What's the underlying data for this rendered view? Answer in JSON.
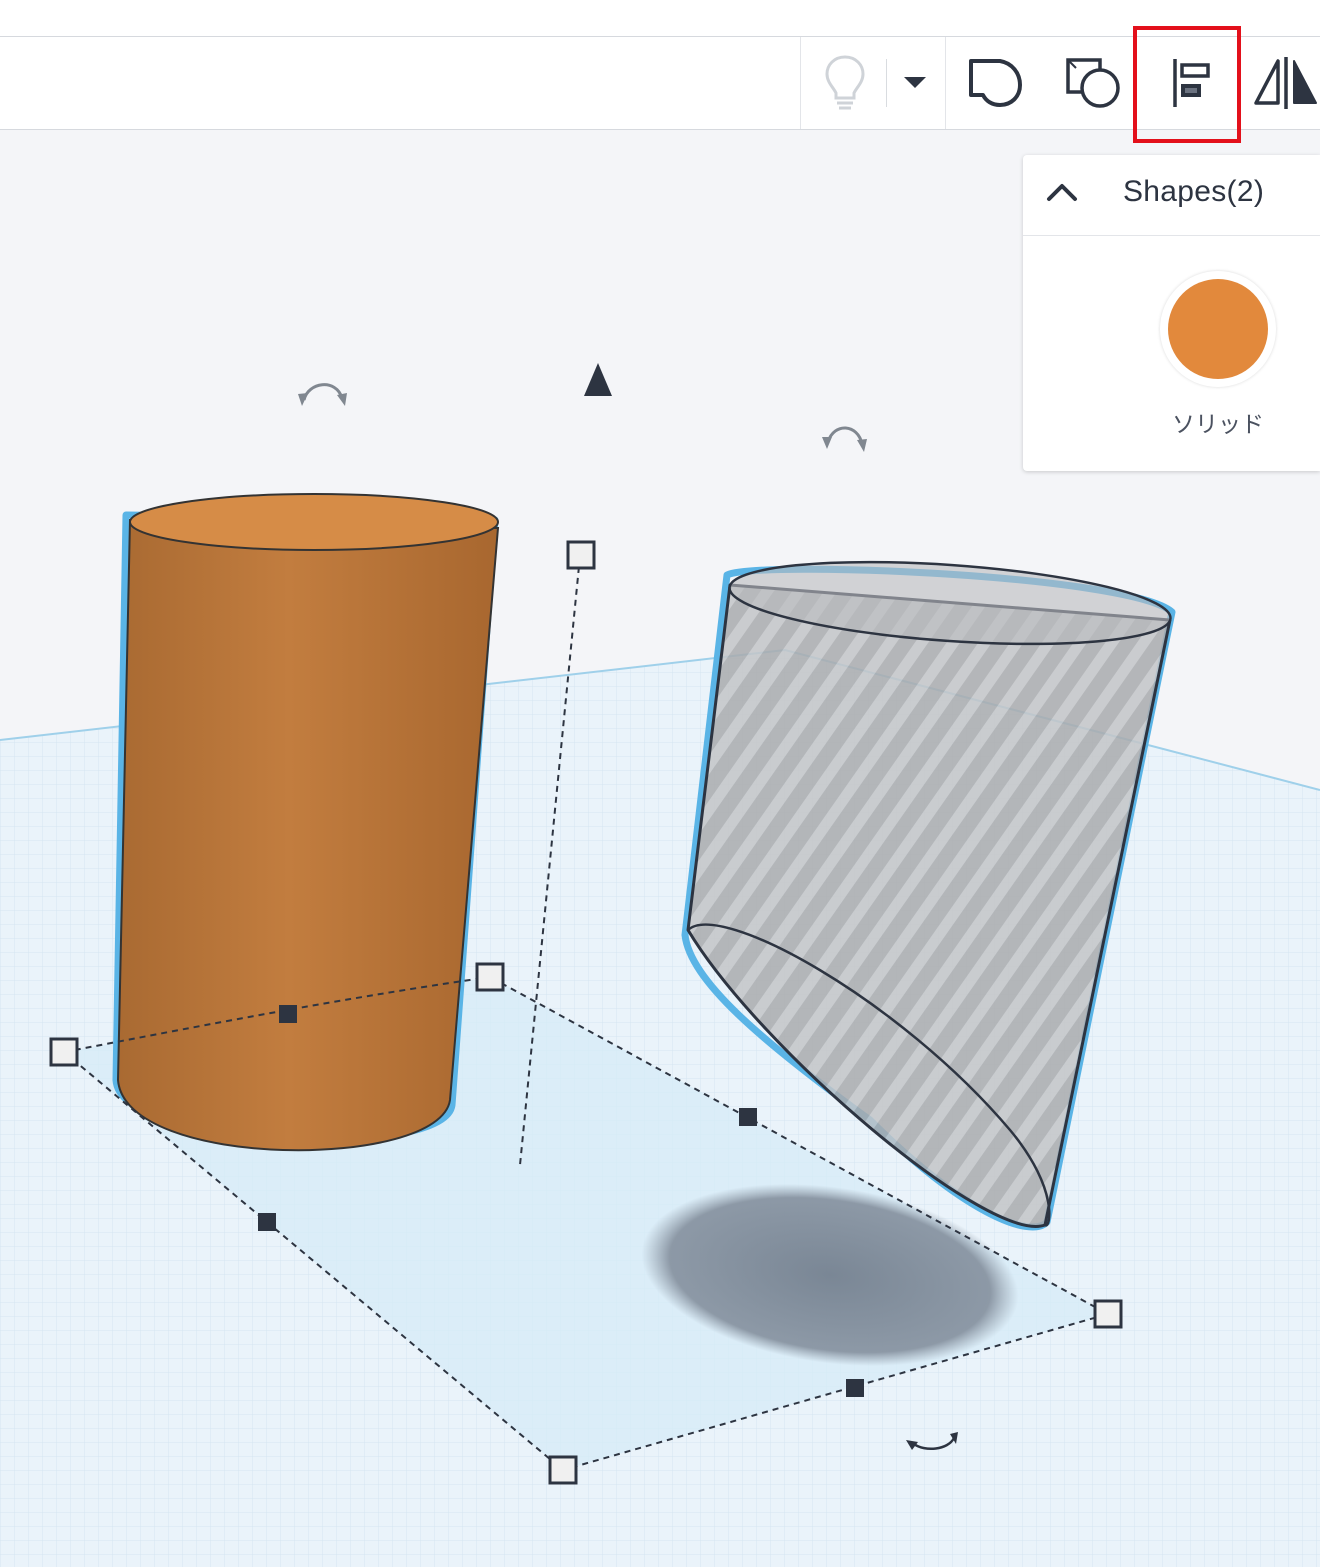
{
  "toolbar": {
    "buttons": [
      {
        "id": "bulb",
        "icon": "lightbulb-icon",
        "state": "disabled"
      },
      {
        "id": "dropdown",
        "icon": "caret-down-icon"
      },
      {
        "id": "solid",
        "icon": "solid-shape-icon"
      },
      {
        "id": "hole",
        "icon": "hole-shape-icon"
      },
      {
        "id": "align",
        "icon": "align-icon",
        "highlighted": true
      },
      {
        "id": "mirror",
        "icon": "mirror-icon"
      }
    ],
    "highlight_color": "#e3101b"
  },
  "shapes_panel": {
    "title": "Shapes(2)",
    "color_label": "ソリッド",
    "color": "#e2893c"
  },
  "scene": {
    "objects": [
      {
        "name": "orange-cylinder",
        "type": "solid",
        "color": "#c57d3e"
      },
      {
        "name": "gray-cylinder",
        "type": "hole",
        "color": "#a9abae"
      }
    ],
    "selection_outline_color": "#5ab4e6",
    "grid_color": "#e3f1f9"
  }
}
